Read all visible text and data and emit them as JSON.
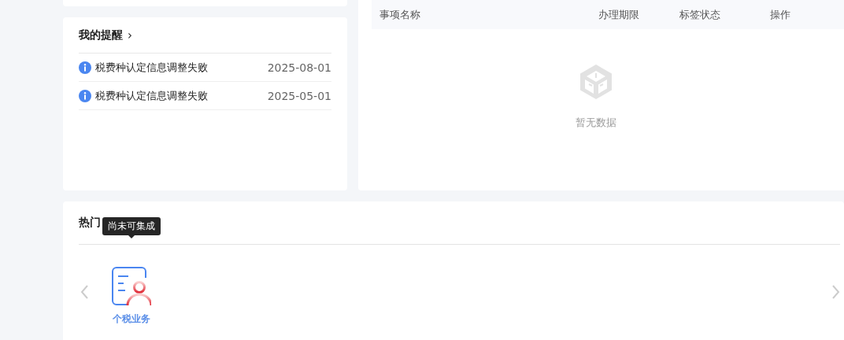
{
  "reminders": {
    "title": "我的提醒",
    "chevron": "›",
    "items": [
      {
        "text": "税费种认定信息调整失败",
        "date": "2025-08-01"
      },
      {
        "text": "税费种认定信息调整失败",
        "date": "2025-05-01"
      }
    ]
  },
  "tasks_table": {
    "columns": [
      "事项名称",
      "办理期限",
      "标签状态",
      "操作"
    ],
    "empty_text": "暂无数据"
  },
  "hot_services": {
    "title": "热门",
    "tooltip": "尚未可集成",
    "items": [
      {
        "label": "个税业务"
      }
    ]
  }
}
